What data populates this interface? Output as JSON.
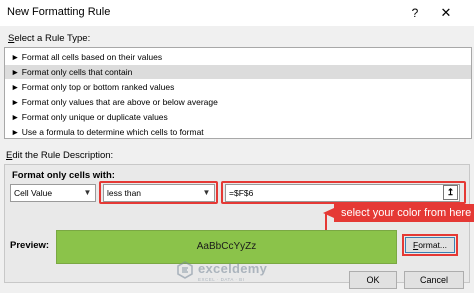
{
  "window": {
    "title": "New Formatting Rule",
    "help_icon": "help-icon",
    "close_icon": "close-icon"
  },
  "rule_type": {
    "label_key": "S",
    "label_rest": "elect a Rule Type:",
    "items": [
      "► Format all cells based on their values",
      "► Format only cells that contain",
      "► Format only top or bottom ranked values",
      "► Format only values that are above or below average",
      "► Format only unique or duplicate values",
      "► Use a formula to determine which cells to format"
    ],
    "selected_index": 1
  },
  "description": {
    "label_key": "E",
    "label_rest": "dit the Rule Description:",
    "format_only_label": "Format only cells with:",
    "condition_type": "Cell Value",
    "operator": "less than",
    "value": "=$F$6"
  },
  "callout": {
    "text": "select your color from here"
  },
  "preview": {
    "label": "Preview:",
    "sample_text": "AaBbCcYyZz",
    "fill_color": "#8bc34a"
  },
  "buttons": {
    "format_key": "F",
    "format_rest": "ormat...",
    "ok": "OK",
    "cancel": "Cancel"
  },
  "watermark": {
    "name": "exceldemy",
    "tagline": "EXCEL · DATA · BI"
  },
  "colors": {
    "highlight_red": "#e53935",
    "selected_row": "#dcdcdc"
  }
}
